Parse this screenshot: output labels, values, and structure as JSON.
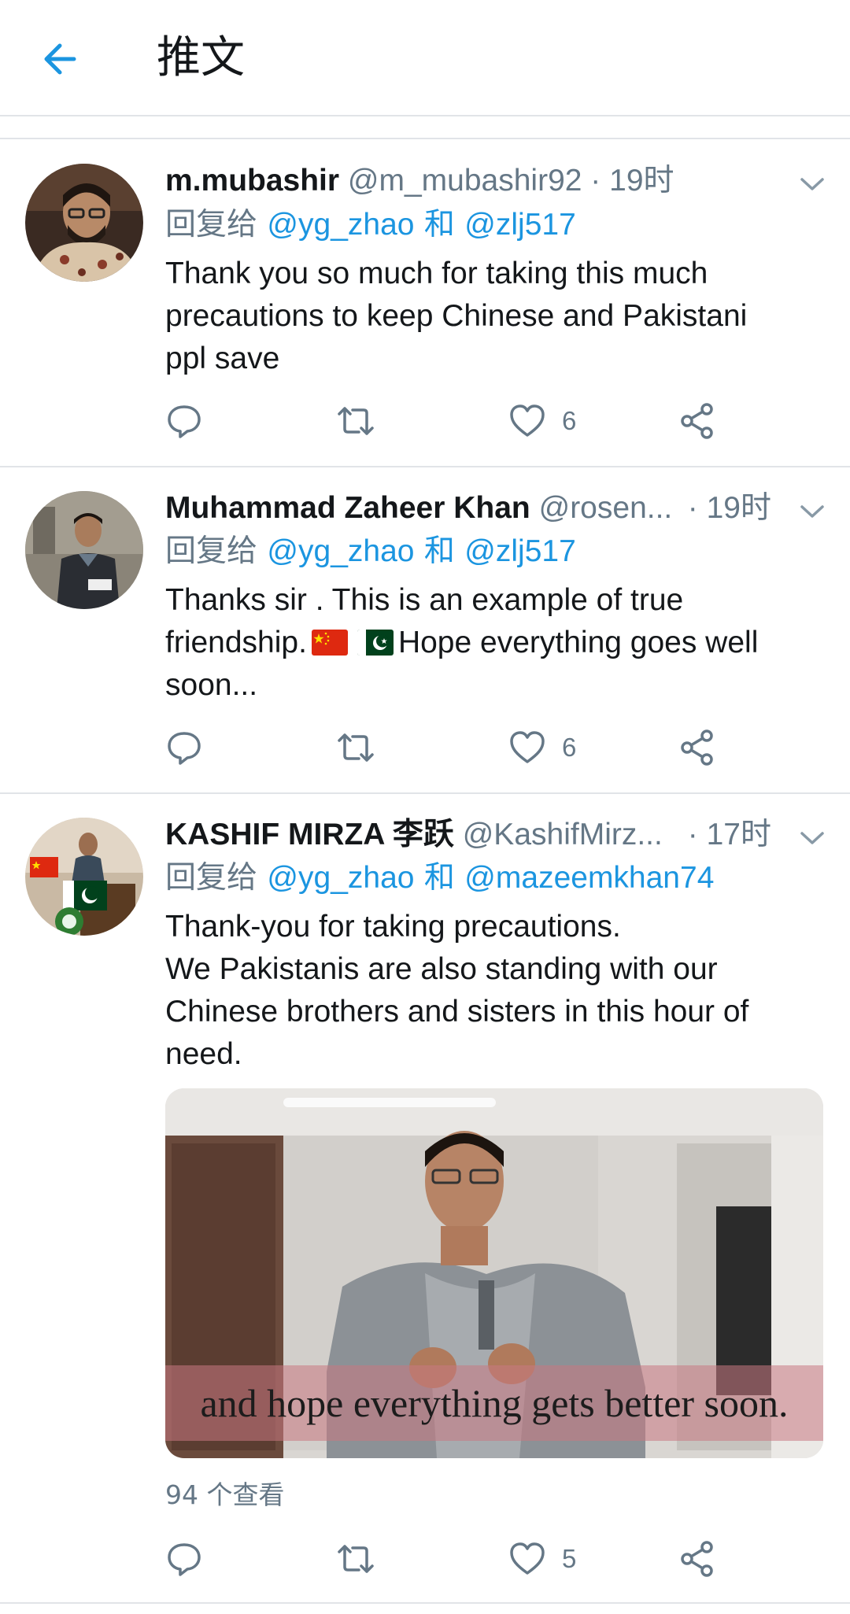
{
  "header": {
    "title": "推文"
  },
  "reply_prefix": "回复给",
  "reply_conj": "和",
  "tweets": [
    {
      "name": "m.mubashir",
      "handle": "@m_mubashir92",
      "time": "19时",
      "reply_to": [
        "@yg_zhao",
        "@zlj517"
      ],
      "text_lines": [
        "Thank you so much for taking this much",
        "precautions to keep Chinese and Pakistani",
        "ppl save"
      ],
      "likes": "6"
    },
    {
      "name": "Muhammad Zaheer Khan",
      "handle": "@rosen...",
      "time": "19时",
      "reply_to": [
        "@yg_zhao",
        "@zlj517"
      ],
      "text_lines": [
        "Thanks sir .  This is an example of true",
        "friendship.",
        "Hope everything goes well",
        "soon..."
      ],
      "likes": "6"
    },
    {
      "name": "KASHIF MIRZA 李跃",
      "handle": "@KashifMirz...",
      "time": "17时",
      "reply_to": [
        "@yg_zhao",
        "@mazeemkhan74"
      ],
      "text_lines": [
        "Thank-you for taking precautions.",
        "We Pakistanis are also standing with our",
        "Chinese brothers and sisters in this hour of",
        "need."
      ],
      "media_caption": "and hope everything gets better soon.",
      "views": "94 个查看",
      "likes": "5"
    }
  ],
  "colors": {
    "accent": "#1b95e0",
    "secondary": "#657786",
    "divider": "#e1e4e8"
  },
  "icons": [
    "back-arrow-icon",
    "chevron-down-icon",
    "reply-icon",
    "retweet-icon",
    "heart-icon",
    "share-icon",
    "china-flag-icon",
    "pakistan-flag-icon"
  ]
}
